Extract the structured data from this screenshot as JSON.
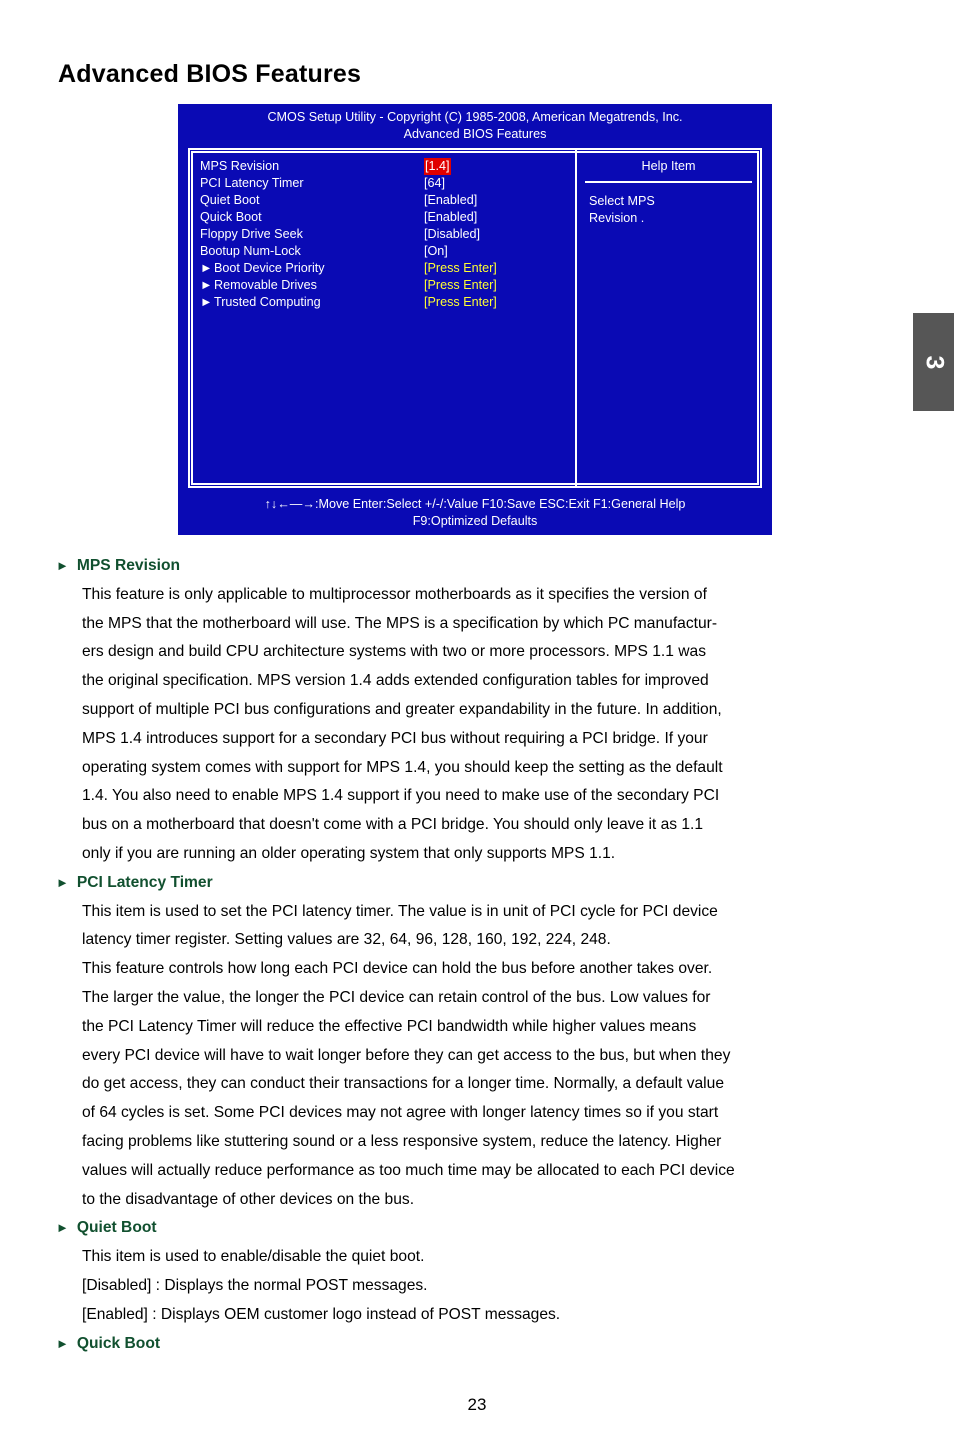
{
  "page": {
    "title": "Advanced BIOS Features",
    "number": "23",
    "chapter_tab": "3"
  },
  "bios": {
    "header_line1": "CMOS Setup Utility - Copyright (C) 1985-2008, American Megatrends, Inc.",
    "header_line2": "Advanced BIOS Features",
    "settings": [
      {
        "label": "MPS Revision",
        "value": "[1.4]",
        "marker": "",
        "style": "highlight"
      },
      {
        "label": "PCI Latency Timer",
        "value": "[64]",
        "marker": "",
        "style": "normal"
      },
      {
        "label": "Quiet Boot",
        "value": "[Enabled]",
        "marker": "",
        "style": "normal"
      },
      {
        "label": "Quick Boot",
        "value": "[Enabled]",
        "marker": "",
        "style": "normal"
      },
      {
        "label": "Floppy Drive Seek",
        "value": "[Disabled]",
        "marker": "",
        "style": "normal"
      },
      {
        "label": "Bootup Num-Lock",
        "value": "[On]",
        "marker": "",
        "style": "normal"
      },
      {
        "label": "Boot Device Priority",
        "value": "[Press Enter]",
        "marker": "►",
        "style": "enter"
      },
      {
        "label": "Removable Drives",
        "value": "[Press Enter]",
        "marker": "►",
        "style": "enter"
      },
      {
        "label": "Trusted Computing",
        "value": "[Press Enter]",
        "marker": "►",
        "style": "enter"
      }
    ],
    "help": {
      "title": "Help Item",
      "line1": "Select MPS",
      "line2": "Revision ."
    },
    "footer": {
      "keys": "↑↓←—→:Move    Enter:Select      +/-/:Value    F10:Save    ESC:Exit    F1:General Help",
      "defaults": "F9:Optimized Defaults"
    },
    "colors": {
      "background": "#0a0ab4",
      "highlight_bg": "#e00000",
      "press_enter_fg": "#ffff33",
      "text": "#ffffff"
    }
  },
  "sections": [
    {
      "heading": "MPS Revision",
      "lines": [
        "This feature is only applicable to multiprocessor motherboards as it specifies the version of",
        "the MPS that the motherboard will use. The MPS is a specification by which PC manufactur-",
        "ers design and build CPU architecture systems with two or more processors. MPS 1.1 was",
        "the original specification. MPS version 1.4 adds extended configuration tables for improved",
        "support of multiple PCI bus configurations and greater expandability in the future. In addition,",
        "MPS 1.4 introduces support for a secondary PCI bus without requiring a PCI bridge. If your",
        "operating system comes with support for MPS 1.4, you should keep the setting as the default",
        "1.4. You also need to enable MPS 1.4 support if you need to make use of the secondary PCI",
        "bus on a motherboard that doesn't come with a PCI bridge. You should only leave it as 1.1",
        "only if you are running an older operating system that only supports MPS 1.1."
      ]
    },
    {
      "heading": "PCI Latency Timer",
      "lines": [
        "This item is used to set the PCI latency timer. The value is in unit of PCI cycle for PCI device",
        "latency timer register. Setting values are 32, 64, 96, 128, 160, 192, 224, 248.",
        "This feature controls how long each PCI device can hold the bus before another takes over.",
        "The larger the value, the longer the PCI device can retain control of the bus. Low values for",
        "the PCI Latency Timer will reduce the effective PCI bandwidth while higher values means",
        "every PCI device will have to wait longer before they can get access to the bus, but when they",
        "do get access, they can conduct their transactions for a longer time. Normally, a default value",
        "of 64 cycles is set. Some PCI devices may not agree with longer latency times so if you start",
        "facing problems like stuttering sound or a less responsive system, reduce the latency. Higher",
        "values will actually reduce performance as too much time may be allocated to each PCI device",
        "to the disadvantage of other devices on the bus."
      ]
    },
    {
      "heading": "Quiet Boot",
      "lines": [
        "This item is used to enable/disable the quiet boot.",
        "[Disabled] : Displays the normal POST messages.",
        "[Enabled] : Displays OEM customer logo instead of POST messages."
      ]
    },
    {
      "heading": "Quick Boot",
      "lines": []
    }
  ]
}
